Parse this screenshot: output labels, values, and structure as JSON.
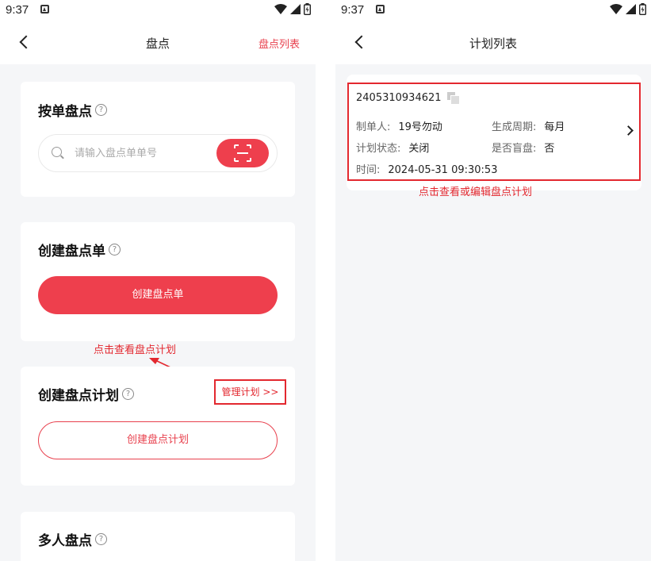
{
  "left": {
    "status": {
      "time": "9:37"
    },
    "nav": {
      "title": "盘点",
      "right_link": "盘点列表"
    },
    "card_order": {
      "title": "按单盘点",
      "help": "?",
      "search_placeholder": "请输入盘点单单号",
      "scan_icon": "scan-icon"
    },
    "card_create_order": {
      "title": "创建盘点单",
      "help": "?",
      "button": "创建盘点单"
    },
    "annotation": "点击查看盘点计划",
    "card_create_plan": {
      "title": "创建盘点计划",
      "help": "?",
      "manage_link": "管理计划 >>",
      "button": "创建盘点计划"
    },
    "card_multi": {
      "title": "多人盘点",
      "help": "?"
    }
  },
  "right": {
    "status": {
      "time": "9:37"
    },
    "nav": {
      "title": "计划列表"
    },
    "plan": {
      "number": "2405310934621",
      "creator_label": "制单人:",
      "creator": "19号勿动",
      "cycle_label": "生成周期:",
      "cycle": "每月",
      "status_label": "计划状态:",
      "status": "关闭",
      "blind_label": "是否盲盘:",
      "blind": "否",
      "time_label": "时间:",
      "time": "2024-05-31 09:30:53"
    },
    "annotation": "点击查看或编辑盘点计划"
  },
  "colors": {
    "accent": "#ee3f4d",
    "annotation": "#e3282f",
    "page_bg": "#f5f6f8"
  }
}
